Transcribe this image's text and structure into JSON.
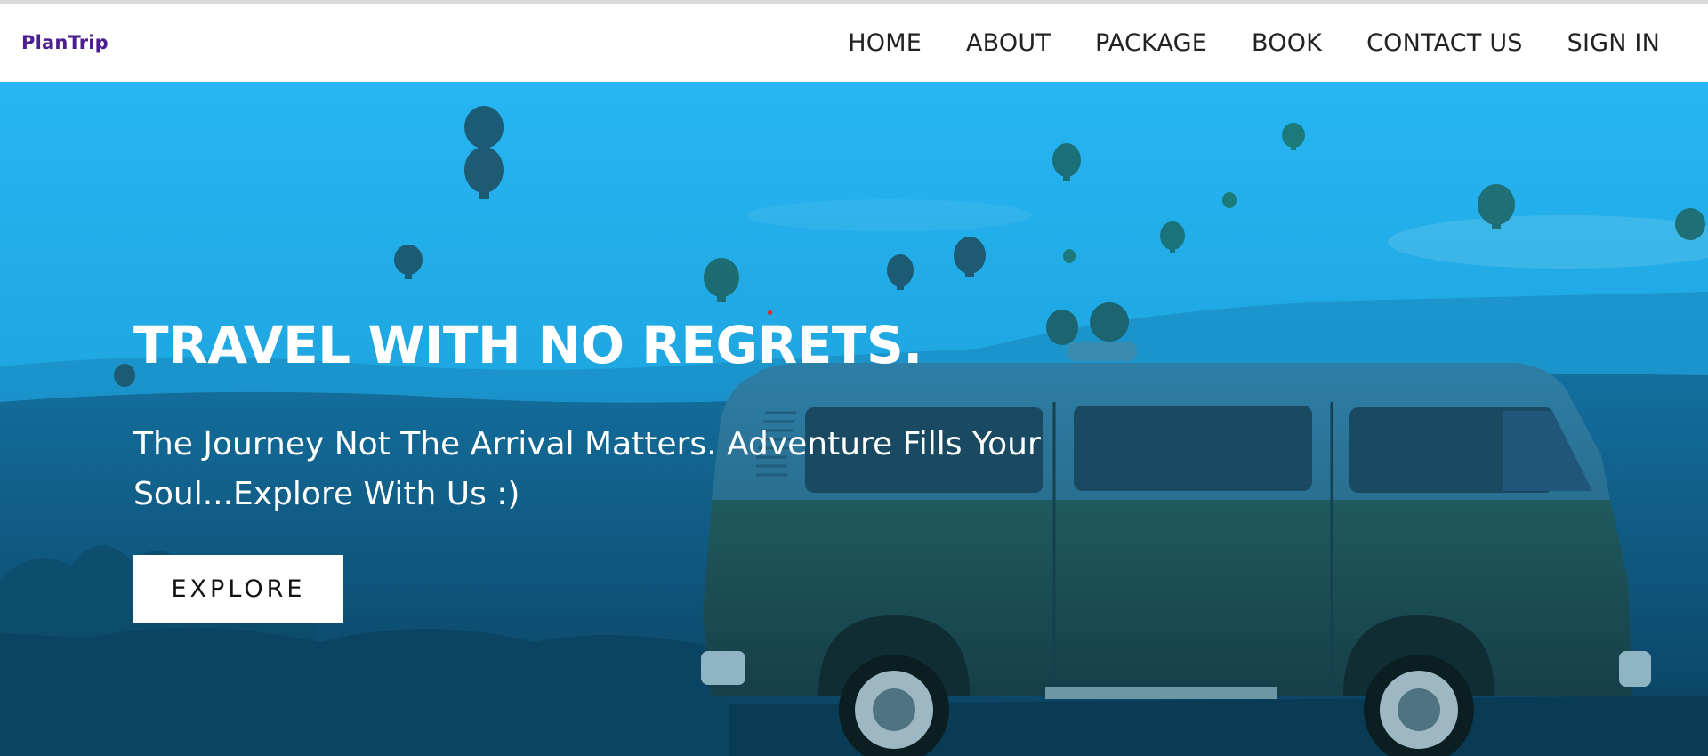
{
  "brand": {
    "name": "PlanTrip"
  },
  "nav": {
    "items": [
      {
        "label": "HOME"
      },
      {
        "label": "ABOUT"
      },
      {
        "label": "PACKAGE"
      },
      {
        "label": "BOOK"
      },
      {
        "label": "CONTACT US"
      },
      {
        "label": "SIGN IN"
      }
    ]
  },
  "hero": {
    "title": "TRAVEL WITH NO REGRETS.",
    "subtitle": "The Journey Not The Arrival Matters. Adventure Fills Your Soul...Explore With Us :)",
    "button_label": "EXPLORE"
  },
  "colors": {
    "brand": "#4b1f8f",
    "hero_overlay": "#1fb2f0",
    "button_bg": "#ffffff"
  }
}
